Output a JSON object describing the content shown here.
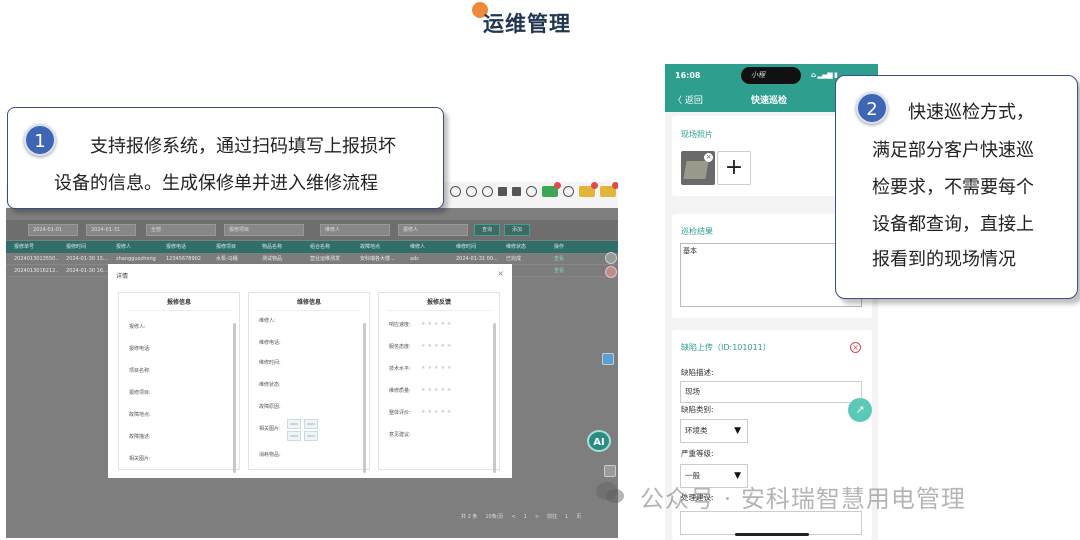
{
  "header": {
    "title": "运维管理"
  },
  "desktop": {
    "filter": {
      "date_start": "2024-01-01",
      "date_end": "2024-01-31",
      "select": "全部",
      "placeholder1": "报修项目",
      "placeholder2": "维修人",
      "placeholder3": "报修人",
      "search_btn": "查询",
      "add_btn": "添加"
    },
    "table_headers": [
      "报修单号",
      "报修时间",
      "报修人",
      "报修电话",
      "报修项目",
      "物品名称",
      "组合名称",
      "故障地点",
      "维修人",
      "维修时间",
      "维修状态",
      "操作"
    ],
    "rows": [
      [
        "2024013013550...",
        "2024-01-30 15...",
        "zhangguozhong",
        "12345678902",
        "水泵-马桶",
        "测试物品",
        "营业运维测发",
        "安科瑞各大楼...",
        "adc",
        "2024-01-31 00...",
        "已完成",
        "查看"
      ],
      [
        "2024013016212...",
        "2024-01-30 16...",
        "",
        "",
        "",
        "",
        "",
        "",
        "",
        "",
        "",
        "查看"
      ]
    ],
    "pager": {
      "total": "共 2 条",
      "page_size": "10条/页",
      "prev": "<",
      "page": "1",
      "next": ">",
      "goto": "前往",
      "goto_page": "1",
      "unit": "页"
    },
    "ai_label": "AI"
  },
  "modal": {
    "title": "详情",
    "close": "×",
    "col1": {
      "heading": "报修信息",
      "fields": [
        "报修人:",
        "报修电话:",
        "项目名称:",
        "报修项目:",
        "故障地点:",
        "故障描述:",
        "相关图片:"
      ]
    },
    "col2": {
      "heading": "维修信息",
      "fields": [
        "维修人:",
        "维修电话:",
        "维修时间:",
        "维修状态:",
        "故障原因:",
        "相关图片:",
        "消耗物品:"
      ],
      "thumbs": [
        "2024",
        "2024",
        "2024",
        "2024"
      ]
    },
    "col3": {
      "heading": "报修反馈",
      "fields": [
        "响应速度:",
        "服务态度:",
        "技术水平:",
        "维修质量:",
        "整体评价:",
        "意见建议:"
      ],
      "stars": "★★★★★"
    }
  },
  "callout1": {
    "number": "1",
    "line1": "支持报修系统，通过扫码填写上报损坏",
    "line2": "设备的信息。生成保修单并进入维修流程"
  },
  "phone": {
    "time": "16:08",
    "island_text": "小程",
    "back": "〈 返回",
    "title": "快速巡检",
    "photo_label": "现场照片",
    "result_label": "巡检结果",
    "result_value": "基本",
    "defect_title": "缺陷上传（ID:101011）",
    "defect_desc_label": "缺陷描述:",
    "defect_desc_value": "现场",
    "defect_type_label": "缺陷类别:",
    "defect_type_value": "环境类",
    "severity_label": "严重等级:",
    "severity_value": "一般",
    "suggest_label": "处理建议:"
  },
  "callout2": {
    "number": "2",
    "lines": [
      "快速巡检方式，",
      "满足部分客户快速巡",
      "检要求，不需要每个",
      "设备都查询，直接上",
      "报看到的现场情况"
    ]
  },
  "watermark": "公众号 · 安科瑞智慧用电管理",
  "colors": {
    "teal": "#2e9e8f",
    "callout_border": "#3a4f83",
    "badge_blue": "#3f66b4"
  }
}
